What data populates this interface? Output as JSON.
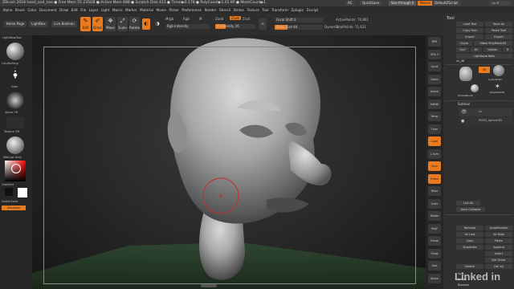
{
  "titlebar": {
    "text": "ZBrush 2018   head_and_neo   ● Free Mem 55.235GB ● Active Mem 688 ● Scratch Disk 413 ● Timer▶0.178 ● PolyCount▶1.01 KP ● MeshCount▶1",
    "ac_label": "AC",
    "quicksave_label": "QuickSave",
    "seethrough_label": "See-through  0",
    "menus_label": "Menus",
    "defaultzscript_label": "DefaultZScript"
  },
  "menubar": {
    "items": [
      "Alpha",
      "Brush",
      "Color",
      "Document",
      "Draw",
      "Edit",
      "File",
      "Layer",
      "Light",
      "Macro",
      "Marker",
      "Material",
      "Movie",
      "Picker",
      "Preferences",
      "Render",
      "Stencil",
      "Stroke",
      "Texture",
      "Tool",
      "Transform",
      "Zplugin",
      "Zscript"
    ]
  },
  "toolbar": {
    "home_page": "Home Page",
    "lightbox": "LightBox",
    "live_boolean": "Live Boolean",
    "edit": "Edit",
    "draw": "Draw",
    "move": "Move",
    "scale": "Scale",
    "rotate": "Rotate",
    "mrgb": "Mrgb",
    "rgb": "Rgb",
    "m": "M",
    "zadd": "Zadd",
    "zsub": "Zsub",
    "zcut": "Zcut",
    "rgb_intensity": "Rgb Intensity",
    "z_intensity": "Z Intensity",
    "z_intensity_value": "26",
    "focal_shift": "Focal Shift",
    "focal_shift_value": "0",
    "draw_size": "Draw Size",
    "draw_size_value": "64",
    "dynamic": "Dynamic",
    "active_points": "ActivePoints: 70,861",
    "total_points": "TotalPoints: 71,631"
  },
  "leftshelf": {
    "shortcut_label": "LightBox▸Tool",
    "brush_label": "ClayBuildup",
    "stroke_label": "Dots",
    "alpha_label": "Alpha Off",
    "texture_label": "Texture Off",
    "material_label": "MatCap Gray",
    "gradient_label": "Gradient",
    "switchcolor_label": "SwitchColor",
    "alternate_label": "Alternate"
  },
  "rightshelf": {
    "buttons": [
      "BPR",
      "SPix 3",
      "Scroll",
      "Zoom",
      "Actual",
      "AAHalf",
      "Persp",
      "Floor",
      "Local",
      "L.Sym",
      "Gxyz",
      "Frame",
      "Move",
      "Scale",
      "Rotate",
      "PolyF",
      "Transp",
      "Ghost",
      "Solo",
      "Xpose"
    ]
  },
  "toolpanel": {
    "title": "Tool",
    "load_tool": "Load Tool",
    "save_as": "Save As",
    "copy_tool": "Copy Tool",
    "paste_tool": "Paste Tool",
    "import": "Import",
    "export": "Export",
    "clone": "Clone",
    "make_polymesh": "Make PolyMesh3D",
    "goz": "GoZ",
    "all": "All",
    "visible": "Visible",
    "r": "R",
    "lightbox_tools": "Lightbox▸Tools",
    "tool_name": "sh_48",
    "tools": [
      "sh_48",
      "Cylinder3D",
      "PolyMesh3D",
      "SimpleBrush"
    ],
    "subtool_title": "Subtool",
    "subtools": [
      "sh",
      "PM3D_Sphere3D"
    ],
    "list_all": "List All",
    "auto_collapse": "Auto Collapse",
    "rename": "Rename",
    "autoreorder": "AutoReorder",
    "all_low": "All Low",
    "all_high": "All High",
    "copy": "Copy",
    "paste": "Paste",
    "duplicate": "Duplicate",
    "append": "Append",
    "insert": "Insert",
    "del_other": "Del Other",
    "delete": "Delete",
    "del_all": "Del All",
    "split": "Split",
    "merge": "Merge",
    "boolean": "Boolean"
  },
  "watermark": "Linked in",
  "colors": {
    "accent": "#e97a1e",
    "panel": "#303030",
    "canvas": "#2a2a2a"
  }
}
